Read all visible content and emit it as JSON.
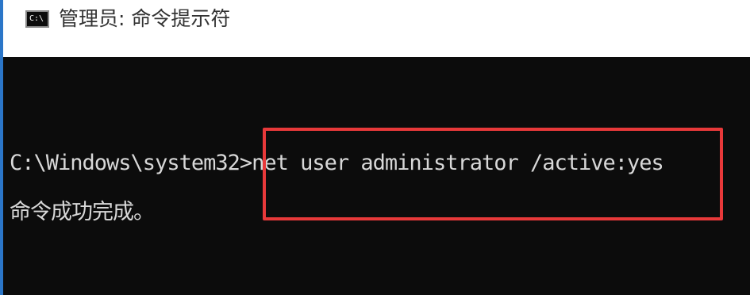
{
  "window": {
    "title": "管理员: 命令提示符",
    "icon": "cmd-icon",
    "icon_glyph": "C:\\",
    "title_bar_bg": "#ffffff",
    "console_bg": "#0c0c0c",
    "text_color": "#d8d8d8",
    "highlight_color": "#e8393a"
  },
  "console": {
    "prompt": "C:\\Windows\\system32>",
    "command": "net user administrator /active:yes",
    "output": "命令成功完成。"
  }
}
